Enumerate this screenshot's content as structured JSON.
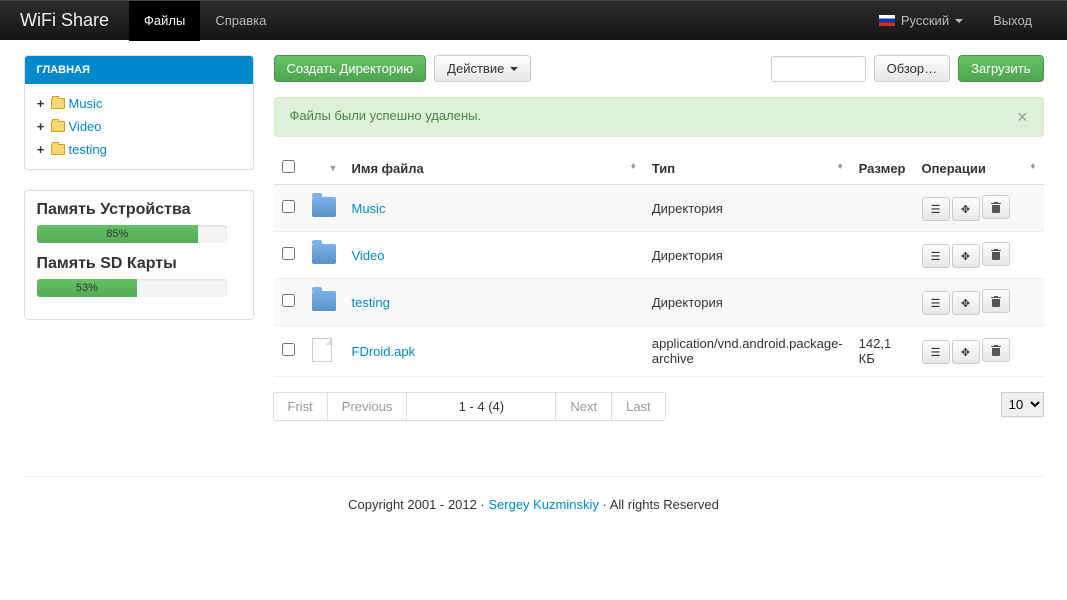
{
  "navbar": {
    "brand": "WiFi Share",
    "files": "Файлы",
    "help": "Справка",
    "language": "Русский",
    "logout": "Выход"
  },
  "sidebar": {
    "header": "ГЛАВНАЯ",
    "tree": [
      {
        "name": "Music"
      },
      {
        "name": "Video"
      },
      {
        "name": "testing"
      }
    ]
  },
  "storage": {
    "device_label": "Память Устройства",
    "device_percent": "85%",
    "device_width": "85%",
    "sd_label": "Память SD Карты",
    "sd_percent": "53%",
    "sd_width": "53%"
  },
  "toolbar": {
    "create_dir": "Создать Директорию",
    "action": "Действие",
    "browse": "Обзор…",
    "upload": "Загрузить"
  },
  "alert": {
    "message": "Файлы были успешно удалены."
  },
  "table": {
    "headers": {
      "name": "Имя файла",
      "type": "Тип",
      "size": "Размер",
      "ops": "Операции"
    },
    "rows": [
      {
        "name": "Music",
        "type": "Директория",
        "size": "",
        "is_dir": true
      },
      {
        "name": "Video",
        "type": "Директория",
        "size": "",
        "is_dir": true
      },
      {
        "name": "testing",
        "type": "Директория",
        "size": "",
        "is_dir": true
      },
      {
        "name": "FDroid.apk",
        "type": "application/vnd.android.package-archive",
        "size": "142,1 КБ",
        "is_dir": false
      }
    ]
  },
  "pagination": {
    "first": "Frist",
    "previous": "Previous",
    "info": "1 - 4 (4)",
    "next": "Next",
    "last": "Last",
    "page_size": "10"
  },
  "footer": {
    "copyright": "Copyright 2001 - 2012 · ",
    "author": "Sergey Kuzminskiy",
    "rights": " · All rights Reserved"
  }
}
